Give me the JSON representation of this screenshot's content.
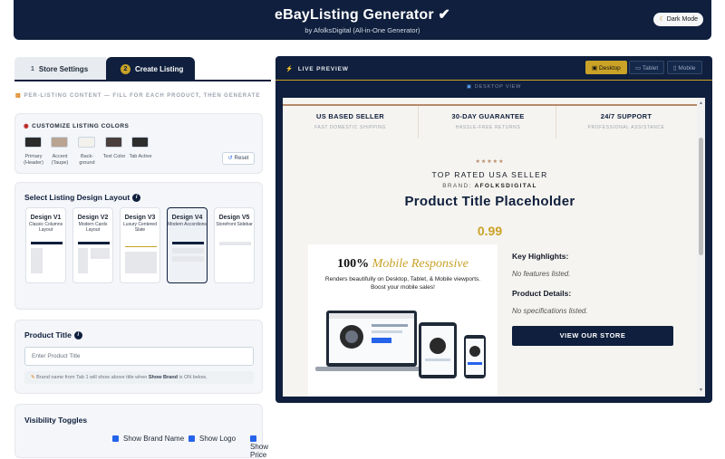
{
  "header": {
    "title": "eBayListing Generator ✔",
    "subtitle": "by AfolksDigital (All-in-One Generator)",
    "dark_mode": "Dark Mode"
  },
  "tabs": [
    {
      "num": "1",
      "label": "Store Settings"
    },
    {
      "num": "2",
      "label": "Create Listing"
    }
  ],
  "section_note": "PER-LISTING CONTENT — FILL FOR EACH PRODUCT, THEN GENERATE",
  "colors": {
    "heading": "CUSTOMIZE LISTING COLORS",
    "swatches": [
      {
        "label": "Primary (Header)",
        "color": "#2b2b2b"
      },
      {
        "label": "Accent (Taupe)",
        "color": "#b9a391"
      },
      {
        "label": "Back-ground",
        "color": "#f2f1ec"
      },
      {
        "label": "Text Color",
        "color": "#4a3f3c"
      },
      {
        "label": "Tab Active",
        "color": "#2d2d2d"
      }
    ],
    "reset": "Reset"
  },
  "layouts": {
    "heading": "Select Listing Design Layout",
    "items": [
      {
        "title": "Design V1",
        "desc": "Classic Columns Layout"
      },
      {
        "title": "Design V2",
        "desc": "Modern Cards Layout"
      },
      {
        "title": "Design V3",
        "desc": "Luxury Centered Slate"
      },
      {
        "title": "Design V4",
        "desc": "Modern Accordions"
      },
      {
        "title": "Design V5",
        "desc": "Storefront Sidebar"
      }
    ],
    "selected": "Design V4"
  },
  "product_title": {
    "label": "Product Title",
    "placeholder": "Enter Product Title",
    "note_prefix": "Brand name from Tab 1 will show above title when ",
    "note_bold": "Show Brand",
    "note_suffix": " is ON below."
  },
  "visibility": {
    "heading": "Visibility Toggles",
    "items": [
      "Show Brand Name",
      "Show Logo",
      "Show Price"
    ]
  },
  "preview": {
    "label": "LIVE PREVIEW",
    "devices": [
      "Desktop",
      "Tablet",
      "Mobile"
    ],
    "active_device": "Desktop",
    "view_label": "DESKTOP VIEW",
    "features": [
      {
        "title": "US BASED SELLER",
        "sub": "FAST DOMESTIC SHIPPING"
      },
      {
        "title": "30-DAY GUARANTEE",
        "sub": "HASSLE-FREE RETURNS"
      },
      {
        "title": "24/7 SUPPORT",
        "sub": "PROFESSIONAL ASSISTANCE"
      }
    ],
    "stars": "★★★★★",
    "top_rated": "TOP RATED USA SELLER",
    "brand_prefix": "BRAND: ",
    "brand_name": "AFOLKSDIGITAL",
    "product_title": "Product Title Placeholder",
    "price": "0.99",
    "promo_title_a": "100% ",
    "promo_title_b": "Mobile Responsive",
    "promo_desc": "Renders beautifully on Desktop, Tablet, & Mobile viewports. Boost your mobile sales!",
    "key_highlights": "Key Highlights:",
    "no_features": "No features listed.",
    "product_details": "Product Details:",
    "no_specs": "No specifications listed.",
    "store_button": "VIEW OUR STORE"
  }
}
